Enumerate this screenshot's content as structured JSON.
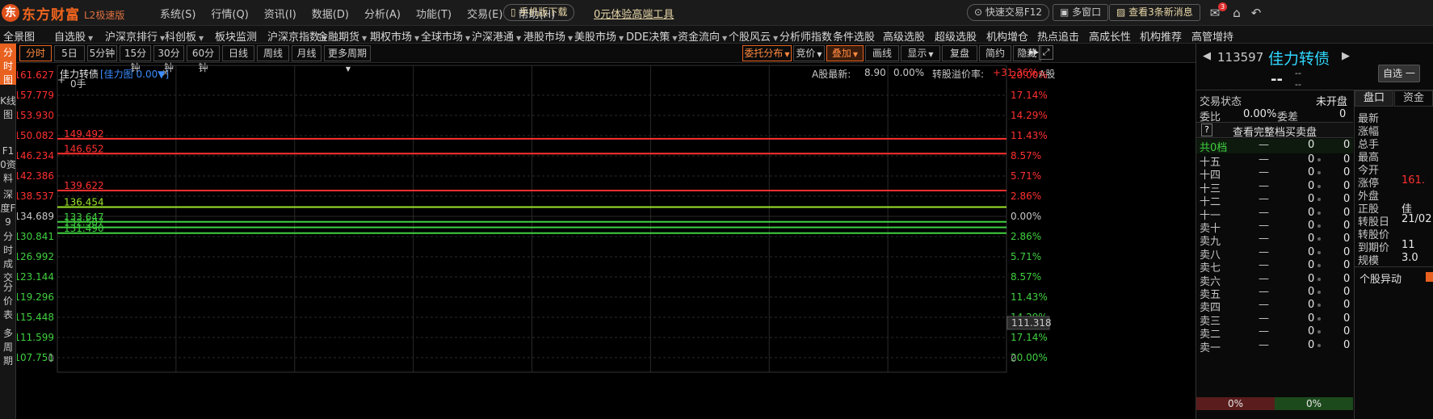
{
  "app": {
    "logo_text": "东方财富",
    "logo_sub": "L2极速版",
    "menu": [
      "系统(S)",
      "行情(Q)",
      "资讯(I)",
      "数据(D)",
      "分析(A)",
      "功能(T)",
      "交易(E)",
      "帮助(H)"
    ],
    "mobile_download": "手机版下载",
    "free_tool_link": "0元体验高端工具",
    "quick_trade": "快速交易F12",
    "multi_window": "多窗口",
    "new_messages": "查看3条新消息",
    "mail_badge": "3"
  },
  "nav": [
    "全景图",
    "自选股",
    "沪深京排行",
    "科创板",
    "板块监测",
    "沪深京指数",
    "金融期货",
    "期权市场",
    "全球市场",
    "沪深港通",
    "港股市场",
    "美股市场",
    "DDE决策",
    "资金流向",
    "个股风云",
    "分析师指数",
    "条件选股",
    "高级选股",
    "超级选股",
    "机构增仓",
    "热点追击",
    "高成长性",
    "机构推荐",
    "高管增持"
  ],
  "left_tabs": [
    {
      "label": "分时图",
      "active": true
    },
    {
      "label": "K线图",
      "active": false
    },
    {
      "label": "F10资料",
      "active": false
    },
    {
      "label": "深度F9",
      "active": false
    },
    {
      "label": "分时成交",
      "active": false
    },
    {
      "label": "分价表",
      "active": false
    },
    {
      "label": "多周期",
      "active": false
    }
  ],
  "toolbar": {
    "periods": [
      "分时",
      "5日",
      "5分钟",
      "15分钟",
      "30分钟",
      "60分钟",
      "日线",
      "周线",
      "月线",
      "更多周期"
    ],
    "right_buttons": [
      "委托分布",
      "竞价",
      "叠加",
      "画线",
      "显示",
      "复盘",
      "简约",
      "隐藏"
    ]
  },
  "chart": {
    "stock_name": "佳力转债",
    "indicator": "[佳力图 0.00▼]",
    "close_mark": "×",
    "volume_label": "0手",
    "a_share_latest_label": "A股最新:",
    "a_share_latest": "8.90",
    "a_share_pct": "0.00%",
    "premium_label": "转股溢价率:",
    "premium_value": "+31.36%",
    "a_share_short": "A股",
    "cursor_price": "111.318",
    "price_ticks": [
      "161.627",
      "157.779",
      "153.930",
      "150.082",
      "146.234",
      "142.386",
      "138.537",
      "134.689",
      "130.841",
      "126.992",
      "123.144",
      "119.296",
      "115.448",
      "111.599",
      "107.751",
      "0"
    ],
    "pct_ticks": [
      "20.00%",
      "17.14%",
      "14.29%",
      "11.43%",
      "8.57%",
      "5.71%",
      "2.86%",
      "0.00%",
      "2.86%",
      "5.71%",
      "8.57%",
      "11.43%",
      "14.29%",
      "17.14%",
      "20.00%",
      "0"
    ],
    "colors": {
      "up": "#ff3030",
      "down": "#40d040",
      "neutral": "#c8c8c8",
      "grid": "#2a2a2a"
    }
  },
  "chart_data": {
    "type": "line",
    "title": "佳力转债",
    "xlabel": "",
    "ylabel": "",
    "ylim": [
      107.751,
      161.627
    ],
    "grid": true,
    "reference_price": 134.689,
    "series": [
      {
        "name": "",
        "values": [
          149.492
        ],
        "color": "#ff3030",
        "label": "149.492"
      },
      {
        "name": "",
        "values": [
          146.652
        ],
        "color": "#ff3030",
        "label": "146.652"
      },
      {
        "name": "",
        "values": [
          139.622
        ],
        "color": "#ff3030",
        "label": "139.622"
      },
      {
        "name": "",
        "values": [
          136.454
        ],
        "color": "#9be52a",
        "label": "136.454"
      },
      {
        "name": "",
        "values": [
          133.647
        ],
        "color": "#40d040",
        "label": "133.647"
      },
      {
        "name": "",
        "values": [
          132.587
        ],
        "color": "#40d040",
        "label": "132.587"
      },
      {
        "name": "",
        "values": [
          131.49
        ],
        "color": "#40d040",
        "label": "131.490"
      }
    ]
  },
  "panel": {
    "code": "113597",
    "name": "佳力转债",
    "price": "--",
    "change_top": "--",
    "change_bottom": "--",
    "watchlist_button": "自选",
    "watch_dash": "一",
    "trade_status_label": "交易状态",
    "trade_status": "未开盘",
    "ratio_label": "委比",
    "ratio_value": "0.00%",
    "diff_label": "委差",
    "diff_value": "0",
    "full_book": "查看完整档买卖盘",
    "help_mark": "?",
    "total_levels": "共0档",
    "book_rows": [
      "十五",
      "十四",
      "十三",
      "十二",
      "十一",
      "卖十",
      "卖九",
      "卖八",
      "卖七",
      "卖六",
      "卖五",
      "卖四",
      "卖三",
      "卖二",
      "卖一"
    ],
    "dash": "—",
    "zero": "0",
    "tabs": [
      "盘口",
      "资金"
    ],
    "info_labels": [
      "最新",
      "涨幅",
      "总手",
      "最高",
      "今开",
      "涨停",
      "外盘",
      "正股",
      "转股日",
      "转股价",
      "到期价",
      "规模"
    ],
    "info_values": [
      "",
      "",
      "",
      "",
      "",
      "161.",
      "",
      "佳",
      "21/02",
      "",
      "11",
      "3.0"
    ],
    "section_label": "个股异动",
    "bid_pct": "0%",
    "ask_pct": "0%"
  }
}
